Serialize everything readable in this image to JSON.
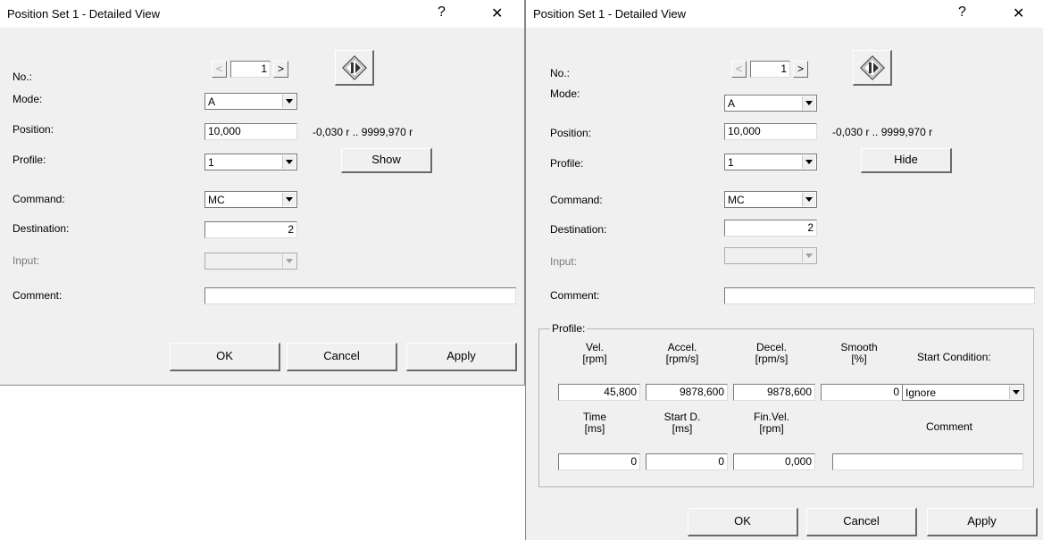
{
  "dialogs": [
    {
      "title": "Position Set 1 - Detailed View",
      "help_glyph": "?",
      "close_glyph": "✕",
      "labels": {
        "no": "No.:",
        "mode": "Mode:",
        "position": "Position:",
        "profile": "Profile:",
        "command": "Command:",
        "destination": "Destination:",
        "input": "Input:",
        "comment": "Comment:"
      },
      "no_value": "1",
      "prev_glyph": "<",
      "next_glyph": ">",
      "mode_value": "A",
      "position_value": "10,000",
      "position_range": "-0,030 r .. 9999,970 r",
      "profile_value": "1",
      "profile_toggle_label": "Show",
      "command_value": "MC",
      "destination_value": "2",
      "input_value": "",
      "comment_value": "",
      "buttons": {
        "ok": "OK",
        "cancel": "Cancel",
        "apply": "Apply"
      }
    },
    {
      "title": "Position Set 1 - Detailed View",
      "help_glyph": "?",
      "close_glyph": "✕",
      "labels": {
        "no": "No.:",
        "mode": "Mode:",
        "position": "Position:",
        "profile": "Profile:",
        "command": "Command:",
        "destination": "Destination:",
        "input": "Input:",
        "comment": "Comment:"
      },
      "no_value": "1",
      "prev_glyph": "<",
      "next_glyph": ">",
      "mode_value": "A",
      "position_value": "10,000",
      "position_range": "-0,030 r .. 9999,970 r",
      "profile_value": "1",
      "profile_toggle_label": "Hide",
      "command_value": "MC",
      "destination_value": "2",
      "input_value": "",
      "comment_value": "",
      "profile_group": {
        "title": "Profile:",
        "headers_row1": {
          "vel": [
            "Vel.",
            "[rpm]"
          ],
          "accel": [
            "Accel.",
            "[rpm/s]"
          ],
          "decel": [
            "Decel.",
            "[rpm/s]"
          ],
          "smooth": [
            "Smooth",
            "[%]"
          ],
          "start_condition": "Start Condition:"
        },
        "values_row1": {
          "vel": "45,800",
          "accel": "9878,600",
          "decel": "9878,600",
          "smooth": "0",
          "start_condition": "Ignore"
        },
        "headers_row2": {
          "time": [
            "Time",
            "[ms]"
          ],
          "start_d": [
            "Start D.",
            "[ms]"
          ],
          "fin_vel": [
            "Fin.Vel.",
            "[rpm]"
          ],
          "comment": "Comment"
        },
        "values_row2": {
          "time": "0",
          "start_d": "0",
          "fin_vel": "0,000",
          "comment": ""
        }
      },
      "buttons": {
        "ok": "OK",
        "cancel": "Cancel",
        "apply": "Apply"
      }
    }
  ],
  "icons": {
    "start_icon": "start-arrow-diamond-icon"
  }
}
